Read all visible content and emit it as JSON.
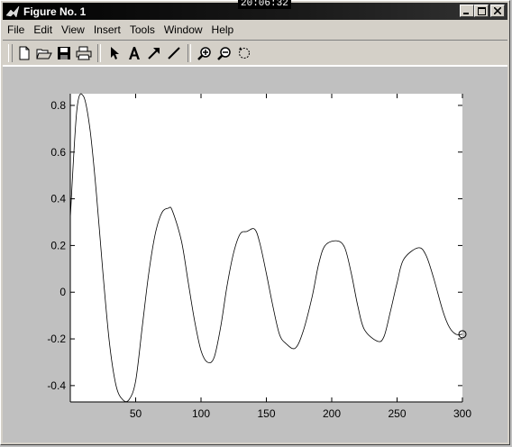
{
  "window": {
    "title": "Figure No. 1",
    "clock": "20:06:32",
    "controls": {
      "minimize": "_",
      "maximize": "□",
      "close": "×"
    }
  },
  "menu": {
    "items": [
      {
        "label": "File"
      },
      {
        "label": "Edit"
      },
      {
        "label": "View"
      },
      {
        "label": "Insert"
      },
      {
        "label": "Tools"
      },
      {
        "label": "Window"
      },
      {
        "label": "Help"
      }
    ]
  },
  "toolbar": {
    "tools": [
      "new-file-icon",
      "open-folder-icon",
      "save-icon",
      "print-icon",
      "pointer-icon",
      "text-icon",
      "arrow-icon",
      "line-icon",
      "zoom-in-icon",
      "zoom-out-icon",
      "rotate-icon"
    ]
  },
  "chart_data": {
    "type": "line",
    "title": "",
    "xlabel": "",
    "ylabel": "",
    "xlim": [
      0,
      300
    ],
    "ylim": [
      -0.47,
      0.85
    ],
    "xticks": [
      50,
      100,
      150,
      200,
      250,
      300
    ],
    "yticks": [
      -0.4,
      -0.2,
      0,
      0.2,
      0.4,
      0.6,
      0.8
    ],
    "grid": false,
    "line_color": "#000000",
    "series": [
      {
        "x": [
          0,
          5,
          10,
          15,
          20,
          25,
          30,
          35,
          40,
          45,
          50,
          55,
          60,
          65,
          70,
          75,
          78,
          85,
          90,
          95,
          100,
          105,
          110,
          115,
          120,
          125,
          130,
          135,
          141,
          145,
          150,
          155,
          160,
          165,
          172,
          178,
          185,
          190,
          195,
          204,
          210,
          215,
          220,
          225,
          235,
          240,
          245,
          250,
          255,
          266,
          272,
          278,
          285,
          290,
          295,
          300
        ],
        "y": [
          0.32,
          0.78,
          0.84,
          0.7,
          0.42,
          0.08,
          -0.22,
          -0.4,
          -0.46,
          -0.46,
          -0.38,
          -0.15,
          0.08,
          0.25,
          0.34,
          0.36,
          0.35,
          0.22,
          0.05,
          -0.12,
          -0.25,
          -0.3,
          -0.28,
          -0.15,
          0.03,
          0.17,
          0.25,
          0.26,
          0.27,
          0.21,
          0.08,
          -0.06,
          -0.18,
          -0.22,
          -0.24,
          -0.17,
          -0.02,
          0.12,
          0.2,
          0.22,
          0.19,
          0.08,
          -0.06,
          -0.16,
          -0.21,
          -0.19,
          -0.08,
          0.04,
          0.14,
          0.19,
          0.16,
          0.06,
          -0.08,
          -0.15,
          -0.18,
          -0.18
        ]
      }
    ],
    "endpoint_marker": {
      "x": 300,
      "y": -0.18,
      "shape": "circle"
    }
  }
}
